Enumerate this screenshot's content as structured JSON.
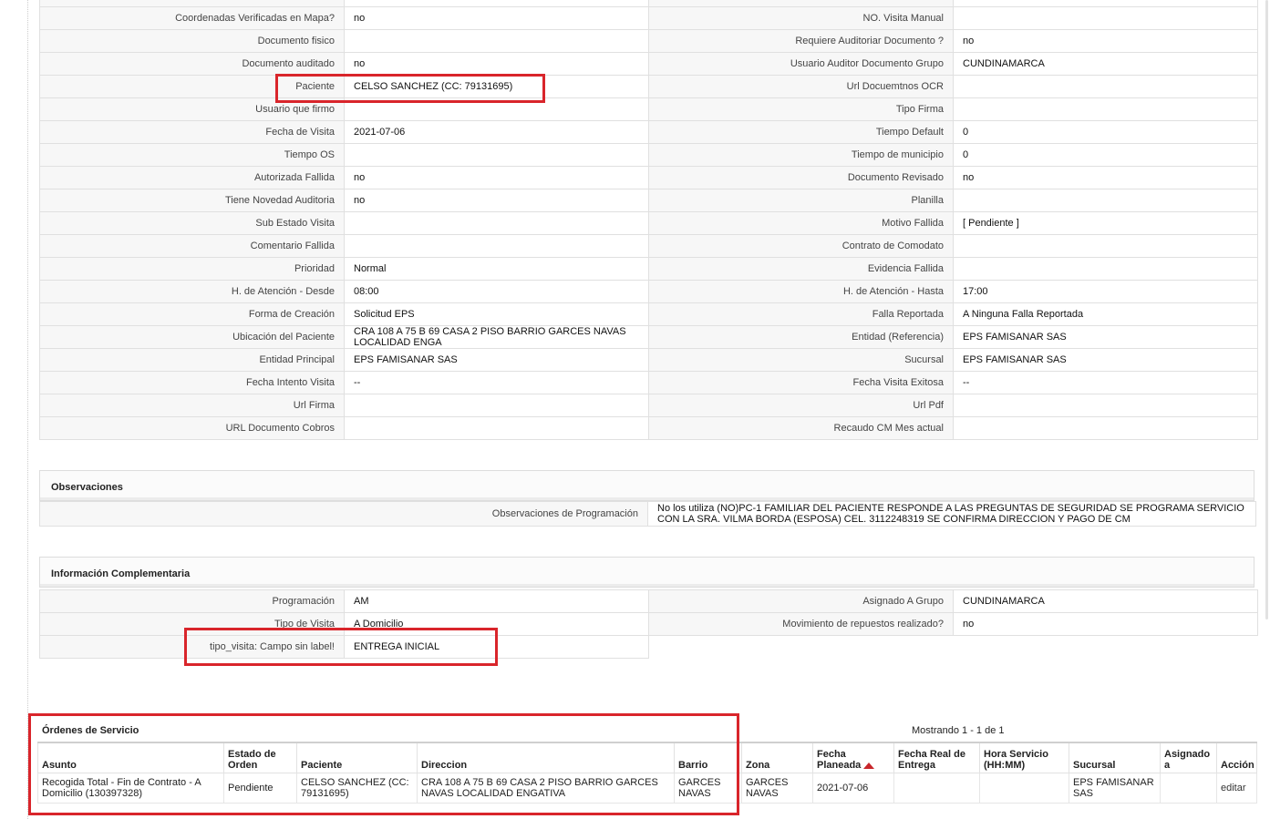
{
  "details": {
    "rows": [
      {
        "l1": "Coordenadas Verificadas en Mapa?",
        "v1": "no",
        "l2": "NO. Visita Manual",
        "v2": ""
      },
      {
        "l1": "Documento fisico",
        "v1": "",
        "l2": "Requiere Auditoriar Documento ?",
        "v2": "no"
      },
      {
        "l1": "Documento auditado",
        "v1": "no",
        "l2": "Usuario Auditor Documento Grupo",
        "v2": "CUNDINAMARCA"
      },
      {
        "l1": "Paciente",
        "v1": "CELSO SANCHEZ (CC: 79131695)",
        "l2": "Url Docuemtnos OCR",
        "v2": ""
      },
      {
        "l1": "Usuario que firmo",
        "v1": "",
        "l2": "Tipo Firma",
        "v2": ""
      },
      {
        "l1": "Fecha de Visita",
        "v1": "2021-07-06",
        "l2": "Tiempo Default",
        "v2": "0"
      },
      {
        "l1": "Tiempo OS",
        "v1": "",
        "l2": "Tiempo de municipio",
        "v2": "0"
      },
      {
        "l1": "Autorizada Fallida",
        "v1": "no",
        "l2": "Documento Revisado",
        "v2": "no"
      },
      {
        "l1": "Tiene Novedad Auditoria",
        "v1": "no",
        "l2": "Planilla",
        "v2": ""
      },
      {
        "l1": "Sub Estado Visita",
        "v1": "",
        "l2": "Motivo Fallida",
        "v2": "[ Pendiente ]"
      },
      {
        "l1": "Comentario Fallida",
        "v1": "",
        "l2": "Contrato de Comodato",
        "v2": ""
      },
      {
        "l1": "Prioridad",
        "v1": "Normal",
        "l2": "Evidencia Fallida",
        "v2": ""
      },
      {
        "l1": "H. de Atención - Desde",
        "v1": "08:00",
        "l2": "H. de Atención - Hasta",
        "v2": "17:00"
      },
      {
        "l1": "Forma de Creación",
        "v1": "Solicitud EPS",
        "l2": "Falla Reportada",
        "v2": "A Ninguna Falla Reportada"
      },
      {
        "l1": "Ubicación del Paciente",
        "v1": "CRA 108 A 75 B 69 CASA 2 PISO BARRIO GARCES NAVAS LOCALIDAD ENGA",
        "l2": "Entidad (Referencia)",
        "v2": "EPS FAMISANAR SAS"
      },
      {
        "l1": "Entidad Principal",
        "v1": "EPS FAMISANAR SAS",
        "l2": "Sucursal",
        "v2": "EPS FAMISANAR SAS"
      },
      {
        "l1": "Fecha Intento Visita",
        "v1": "--",
        "l2": "Fecha Visita Exitosa",
        "v2": "--"
      },
      {
        "l1": "Url Firma",
        "v1": "",
        "l2": "Url Pdf",
        "v2": ""
      },
      {
        "l1": "URL Documento Cobros",
        "v1": "",
        "l2": "Recaudo CM Mes actual",
        "v2": ""
      }
    ]
  },
  "observaciones": {
    "title": "Observaciones",
    "label": "Observaciones de Programación",
    "value": " No los utiliza (NO)PC-1 FAMILIAR DEL PACIENTE RESPONDE A LAS PREGUNTAS DE SEGURIDAD SE PROGRAMA SERVICIO CON LA SRA. VILMA BORDA (ESPOSA) CEL. 3112248319 SE CONFIRMA DIRECCION Y PAGO DE CM"
  },
  "complementaria": {
    "title": "Información Complementaria",
    "rows": [
      {
        "l1": "Programación",
        "v1": "AM",
        "l2": "Asignado A Grupo",
        "v2": "CUNDINAMARCA"
      },
      {
        "l1": "Tipo de Visita",
        "v1": "A Domicilio",
        "l2": "Movimiento de repuestos realizado?",
        "v2": "no"
      },
      {
        "l1": "tipo_visita: Campo sin label!",
        "v1": "ENTREGA INICIAL"
      }
    ]
  },
  "ordenes": {
    "title": "Órdenes de Servicio",
    "count": "Mostrando 1 - 1 de 1",
    "headers": [
      "Asunto",
      "Estado de Orden",
      "Paciente",
      "Direccion",
      "Barrio",
      "Zona",
      "Fecha Planeada",
      "Fecha Real de Entrega",
      "Hora Servicio (HH:MM)",
      "Sucursal",
      "Asignado a",
      "Acción"
    ],
    "rows": [
      {
        "asunto": "Recogida Total - Fin de Contrato - A Domicilio (130397328)",
        "estado": "Pendiente",
        "paciente": "CELSO SANCHEZ (CC: 79131695)",
        "direccion": "CRA 108 A 75 B 69 CASA 2 PISO BARRIO GARCES NAVAS LOCALIDAD ENGATIVA",
        "barrio": "GARCES NAVAS",
        "zona": "GARCES NAVAS",
        "fecha_planeada": "2021-07-06",
        "fecha_real": "",
        "hora": "",
        "sucursal": "EPS FAMISANAR SAS",
        "asignado": "",
        "accion": "editar"
      }
    ]
  },
  "colors": {
    "highlight": "#d9252b",
    "sort_arrow": "#c8262b"
  }
}
